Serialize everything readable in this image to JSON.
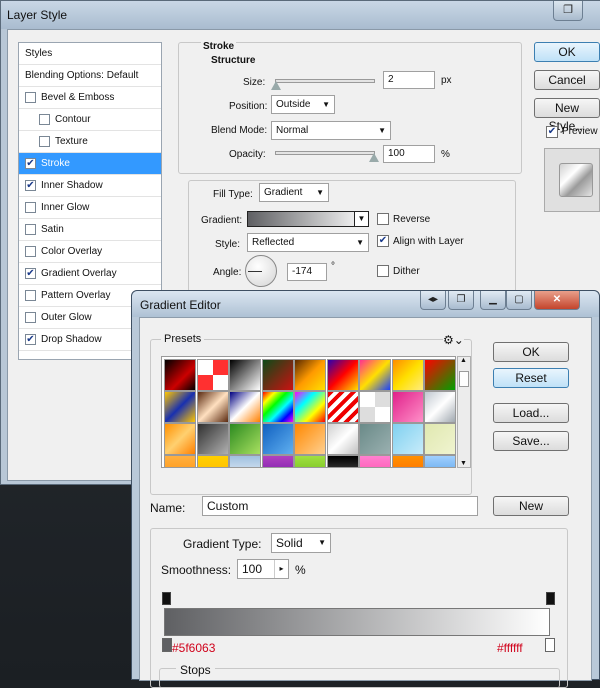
{
  "layer_style": {
    "title": "Layer Style",
    "styles_header": "Styles",
    "blending_options": "Blending Options: Default",
    "items": [
      {
        "label": "Bevel & Emboss",
        "checked": false,
        "indent": false,
        "selected": false
      },
      {
        "label": "Contour",
        "checked": false,
        "indent": true,
        "selected": false
      },
      {
        "label": "Texture",
        "checked": false,
        "indent": true,
        "selected": false
      },
      {
        "label": "Stroke",
        "checked": true,
        "indent": false,
        "selected": true
      },
      {
        "label": "Inner Shadow",
        "checked": true,
        "indent": false,
        "selected": false
      },
      {
        "label": "Inner Glow",
        "checked": false,
        "indent": false,
        "selected": false
      },
      {
        "label": "Satin",
        "checked": false,
        "indent": false,
        "selected": false
      },
      {
        "label": "Color Overlay",
        "checked": false,
        "indent": false,
        "selected": false
      },
      {
        "label": "Gradient Overlay",
        "checked": true,
        "indent": false,
        "selected": false
      },
      {
        "label": "Pattern Overlay",
        "checked": false,
        "indent": false,
        "selected": false
      },
      {
        "label": "Outer Glow",
        "checked": false,
        "indent": false,
        "selected": false
      },
      {
        "label": "Drop Shadow",
        "checked": true,
        "indent": false,
        "selected": false
      }
    ],
    "buttons": {
      "ok": "OK",
      "cancel": "Cancel",
      "new_style": "New Style...",
      "preview": "Preview"
    },
    "stroke": {
      "heading": "Stroke",
      "structure": "Structure",
      "size_label": "Size:",
      "size_value": "2",
      "size_unit": "px",
      "position_label": "Position:",
      "position_value": "Outside",
      "blend_mode_label": "Blend Mode:",
      "blend_mode_value": "Normal",
      "opacity_label": "Opacity:",
      "opacity_value": "100",
      "opacity_unit": "%",
      "fill_type_label": "Fill Type:",
      "fill_type_value": "Gradient",
      "gradient_label": "Gradient:",
      "reverse_label": "Reverse",
      "style_label": "Style:",
      "style_value": "Reflected",
      "align_label": "Align with Layer",
      "angle_label": "Angle:",
      "angle_value": "-174",
      "angle_unit": "°",
      "dither_label": "Dither"
    }
  },
  "gradient_editor": {
    "title": "Gradient Editor",
    "presets_label": "Presets",
    "buttons": {
      "ok": "OK",
      "reset": "Reset",
      "load": "Load...",
      "save": "Save...",
      "new": "New"
    },
    "name_label": "Name:",
    "name_value": "Custom",
    "gradient_type_label": "Gradient Type:",
    "gradient_type_value": "Solid",
    "smoothness_label": "Smoothness:",
    "smoothness_value": "100",
    "smoothness_unit": "%",
    "left_color": "#5f6063",
    "right_color": "#ffffff",
    "stops_label": "Stops"
  },
  "colors": {
    "selection": "#3399ff",
    "hex_text": "#d0021b",
    "gradient_start": "#5f6063",
    "gradient_end": "#ffffff"
  },
  "presets": [
    "linear-gradient(135deg,#000,#c00 60%,#000)",
    "repeating-conic-gradient(#ff3030 0 25%,#ffffff 0 50%)",
    "linear-gradient(135deg,#000,#fff)",
    "linear-gradient(135deg,#0c4a17,#c11 100%)",
    "linear-gradient(135deg,#5a2a00,#ff9a00,#ffe000)",
    "linear-gradient(135deg,#2a00b0,#ff0000,#ffe000)",
    "linear-gradient(135deg,#ff3090,#ffe000,#1840ff)",
    "linear-gradient(135deg,#ff8c00,#ffe000,#ffec80)",
    "linear-gradient(135deg,#ff0000,#00a000)",
    "linear-gradient(135deg,#ffc600,#1830b0,#ffc600)",
    "linear-gradient(135deg,#5a2a10,#ffe0c0,#5a2a10)",
    "linear-gradient(135deg,#000080,#ffffff 50%,#ff8000)",
    "linear-gradient(135deg,#ff0000,#ffff00,#00ff00,#00ffff,#0000ff,#ff00ff)",
    "linear-gradient(135deg,#ff00ff,#00ffff,#ffff00,#ff0000)",
    "repeating-linear-gradient(135deg,#e00 0 4px,#fff 4px 8px)",
    "repeating-conic-gradient(#ddd 0 25%,#ffffff 0 50%)",
    "linear-gradient(135deg,#e0208a,#ff90c8)",
    "linear-gradient(135deg,#c0c8d0,#ffffff,#a0a8b0)",
    "linear-gradient(135deg,#ff9000,#ffd070,#ff8000)",
    "linear-gradient(135deg,#303030,#b0b0b0)",
    "linear-gradient(135deg,#2c8a20,#a8e060)",
    "linear-gradient(135deg,#1060c0,#60b0f0)",
    "linear-gradient(135deg,#ff8800,#ffd090)",
    "linear-gradient(135deg,#d0d0d0,#ffffff,#c0c0c0)",
    "linear-gradient(135deg,#6a8a88,#9ab0b0)",
    "linear-gradient(135deg,#80d0f0,#c8ecfa)",
    "linear-gradient(135deg,#e0e8b0,#f0f4d0)",
    "linear-gradient(180deg,#ffb040,#ff8a00)",
    "linear-gradient(180deg,#ffd000,#ffb000)",
    "linear-gradient(180deg,#a0c0e0,#ffffff)",
    "linear-gradient(180deg,#b040c0,#6010a0)",
    "linear-gradient(180deg,#a0e040,#60b010)",
    "linear-gradient(180deg,#000000,#707070)",
    "linear-gradient(180deg,#ff80d0,#ff40a0)",
    "linear-gradient(180deg,#ff9000,#ff6000)",
    "linear-gradient(180deg,#a0d0ff,#4090e0)"
  ]
}
